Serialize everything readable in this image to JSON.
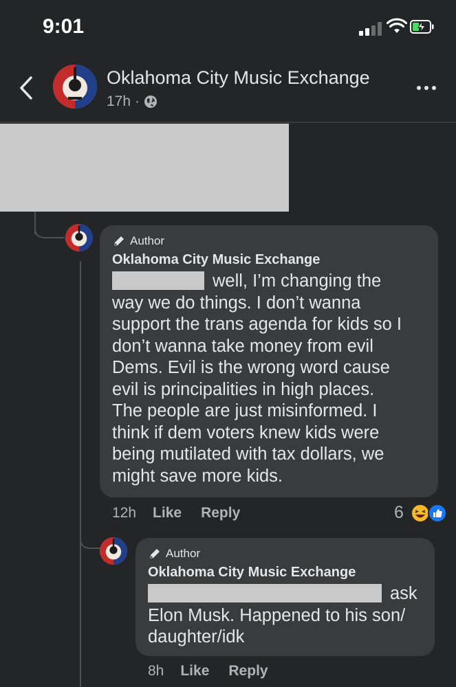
{
  "status_bar": {
    "time": "9:01"
  },
  "header": {
    "page_name": "Oklahoma City Music Exchange",
    "time_ago": "17h",
    "separator": "·"
  },
  "comments": [
    {
      "badge": "Author",
      "name": "Oklahoma City Music Exchange",
      "text_first_line": "well, I’m changing the",
      "text_rest": [
        "way we do things. I don’t wanna",
        "support the trans agenda for kids so I",
        "don’t wanna take money from evil",
        "Dems.  Evil is the wrong word cause",
        "evil is principalities in high places.",
        "The people are just misinformed.  I",
        "think if dem voters knew kids were",
        "being mutilated with tax dollars, we",
        "might save more kids."
      ],
      "time": "12h",
      "like_label": "Like",
      "reply_label": "Reply",
      "reaction_count": "6",
      "reactions": [
        "haha-icon",
        "like-icon"
      ]
    },
    {
      "badge": "Author",
      "name": "Oklahoma City Music Exchange",
      "text_first_line": "ask",
      "text_rest": [
        "Elon Musk. Happened to his son/",
        "daughter/idk"
      ],
      "time": "8h",
      "like_label": "Like",
      "reply_label": "Reply"
    }
  ],
  "colors": {
    "background": "#242526",
    "bubble": "#3a3b3c",
    "text": "#e4e6eb",
    "secondary_text": "#b0b3b8",
    "like_blue": "#1877f2",
    "haha_yellow": "#f7b928"
  }
}
